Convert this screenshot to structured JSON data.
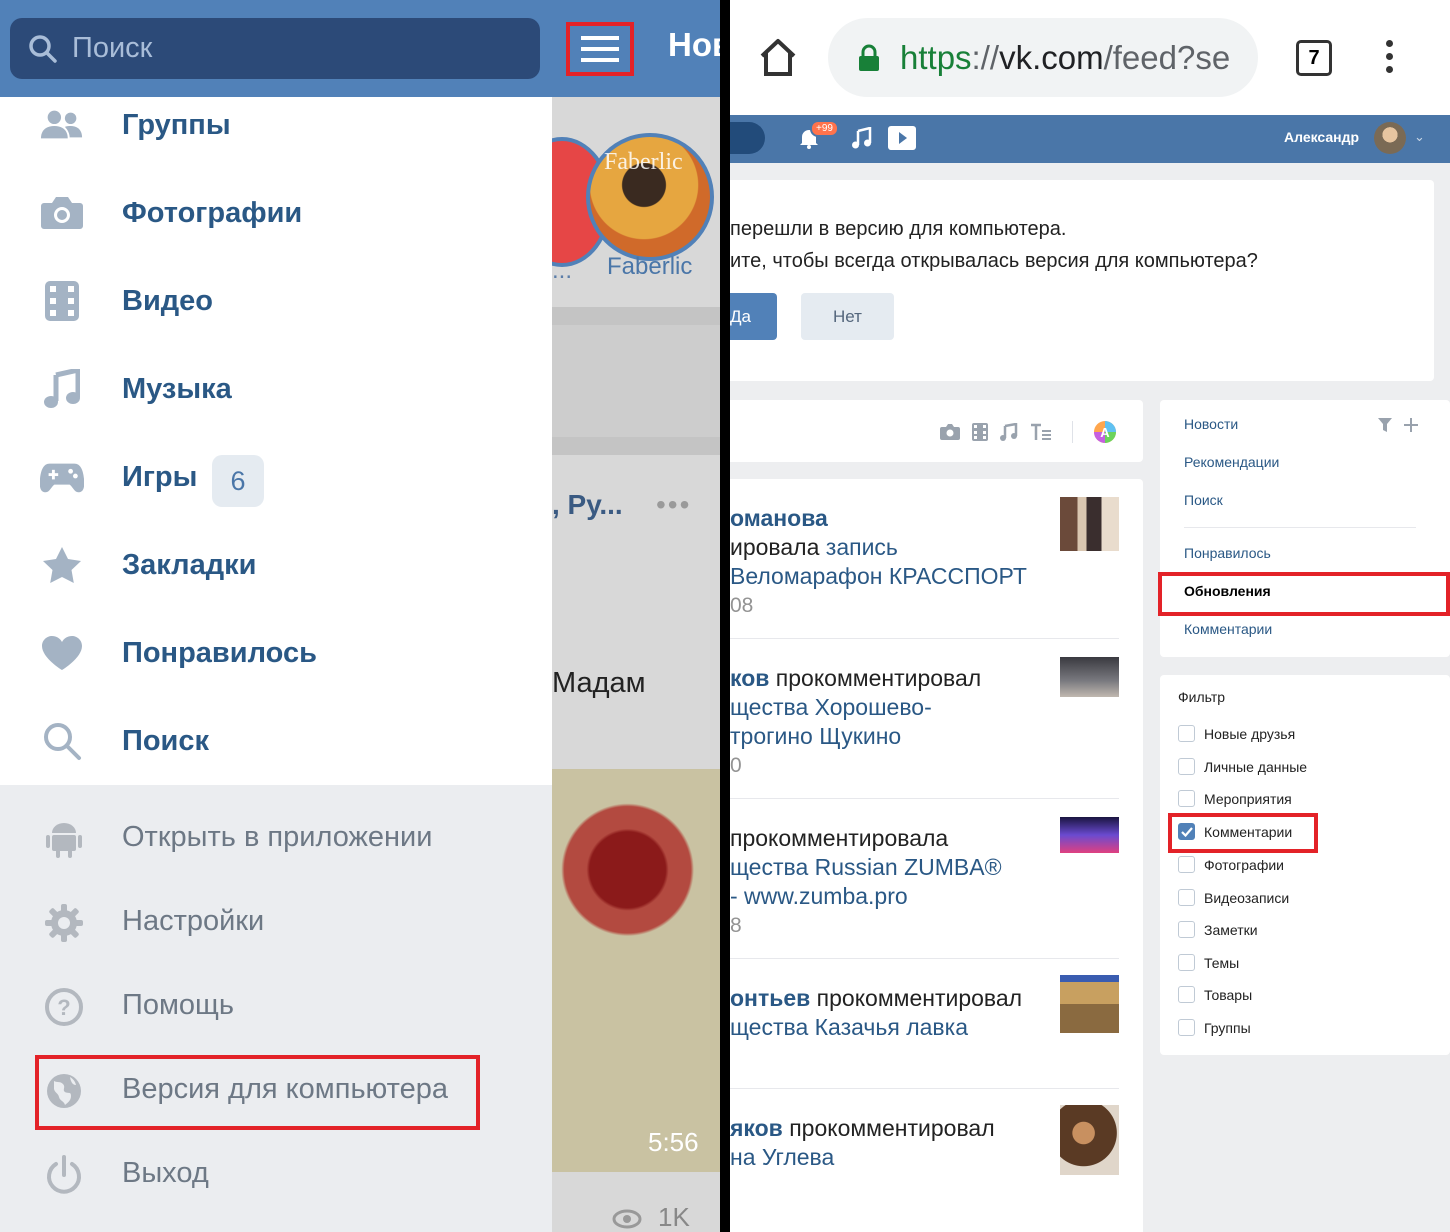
{
  "left": {
    "search_placeholder": "Поиск",
    "header_title": "Нов",
    "menu": [
      {
        "label": "Группы",
        "icon": "groups-icon"
      },
      {
        "label": "Фотографии",
        "icon": "camera-icon"
      },
      {
        "label": "Видео",
        "icon": "video-icon"
      },
      {
        "label": "Музыка",
        "icon": "music-icon"
      },
      {
        "label": "Игры",
        "icon": "gamepad-icon",
        "badge": "6"
      },
      {
        "label": "Закладки",
        "icon": "star-icon"
      },
      {
        "label": "Понравилось",
        "icon": "heart-icon"
      },
      {
        "label": "Поиск",
        "icon": "search-icon"
      }
    ],
    "bottom_menu": [
      {
        "label": "Открыть в приложении",
        "icon": "android-icon"
      },
      {
        "label": "Настройки",
        "icon": "gear-icon"
      },
      {
        "label": "Помощь",
        "icon": "help-icon"
      },
      {
        "label": "Версия для компьютера",
        "icon": "globe-icon",
        "highlighted": true
      },
      {
        "label": "Выход",
        "icon": "power-icon"
      }
    ],
    "background_feed": {
      "story1_label": "...",
      "story2_label": "Faberlic",
      "story2_logo": "Faberlic",
      "post_author": ", Ру...",
      "post_dots": "•••",
      "post_text": "Мадам",
      "video_duration": "5:56",
      "views": "1K"
    }
  },
  "right": {
    "url_scheme": "https",
    "url_sep": "://",
    "url_host": "vk.com",
    "url_path": "/feed?se",
    "tab_count": "7",
    "notification_badge": "+99",
    "user_name": "Александр",
    "notice_line1": "перешли в версию для компьютера.",
    "notice_line2": "ите, чтобы всегда открывалась версия для компьютера?",
    "btn_yes": "Да",
    "btn_no": "Нет",
    "posts": [
      {
        "lines": [
          [
            {
              "t": "оманова",
              "c": "blue",
              "b": true
            }
          ],
          [
            {
              "t": "ировала ",
              "c": "dark"
            },
            {
              "t": "запись",
              "c": "blue"
            }
          ],
          [
            {
              "t": " Веломарафон КРАССПОРТ",
              "c": "blue"
            }
          ],
          [
            {
              "t": "08",
              "c": "grey"
            }
          ]
        ]
      },
      {
        "lines": [
          [
            {
              "t": "ков",
              "c": "blue",
              "b": true
            },
            {
              "t": " прокомментировал",
              "c": "dark"
            }
          ],
          [
            {
              "t": "щества Хорошево-",
              "c": "blue"
            }
          ],
          [
            {
              "t": "трогино Щукино",
              "c": "blue"
            }
          ],
          [
            {
              "t": "0",
              "c": "grey"
            }
          ]
        ]
      },
      {
        "lines": [
          [
            {
              "t": " прокомментировала",
              "c": "dark"
            }
          ],
          [
            {
              "t": "щества Russian ZUMBA®",
              "c": "blue"
            }
          ],
          [
            {
              "t": "- www.zumba.pro",
              "c": "blue"
            }
          ],
          [
            {
              "t": "8",
              "c": "grey"
            }
          ]
        ]
      },
      {
        "lines": [
          [
            {
              "t": "онтьев",
              "c": "blue",
              "b": true
            },
            {
              "t": " прокомментировал",
              "c": "dark"
            }
          ],
          [
            {
              "t": "щества Казачья лавка",
              "c": "blue"
            }
          ]
        ]
      },
      {
        "lines": [
          [
            {
              "t": "яков",
              "c": "blue",
              "b": true
            },
            {
              "t": " прокомментировал",
              "c": "dark"
            }
          ],
          [
            {
              "t": "на Углева",
              "c": "blue"
            }
          ]
        ]
      }
    ],
    "sidebar": {
      "news": "Новости",
      "recommendations": "Рекомендации",
      "search": "Поиск",
      "liked": "Понравилось",
      "updates": "Обновления",
      "comments": "Комментарии"
    },
    "filter": {
      "title": "Фильтр",
      "items": [
        {
          "label": "Новые друзья",
          "checked": false
        },
        {
          "label": "Личные данные",
          "checked": false
        },
        {
          "label": "Мероприятия",
          "checked": false
        },
        {
          "label": "Комментарии",
          "checked": true
        },
        {
          "label": "Фотографии",
          "checked": false
        },
        {
          "label": "Видеозаписи",
          "checked": false
        },
        {
          "label": "Заметки",
          "checked": false
        },
        {
          "label": "Темы",
          "checked": false
        },
        {
          "label": "Товары",
          "checked": false
        },
        {
          "label": "Группы",
          "checked": false
        }
      ]
    }
  },
  "colors": {
    "vk_blue": "#5181b8",
    "highlight_red": "#e32228",
    "link": "#2a5885"
  }
}
